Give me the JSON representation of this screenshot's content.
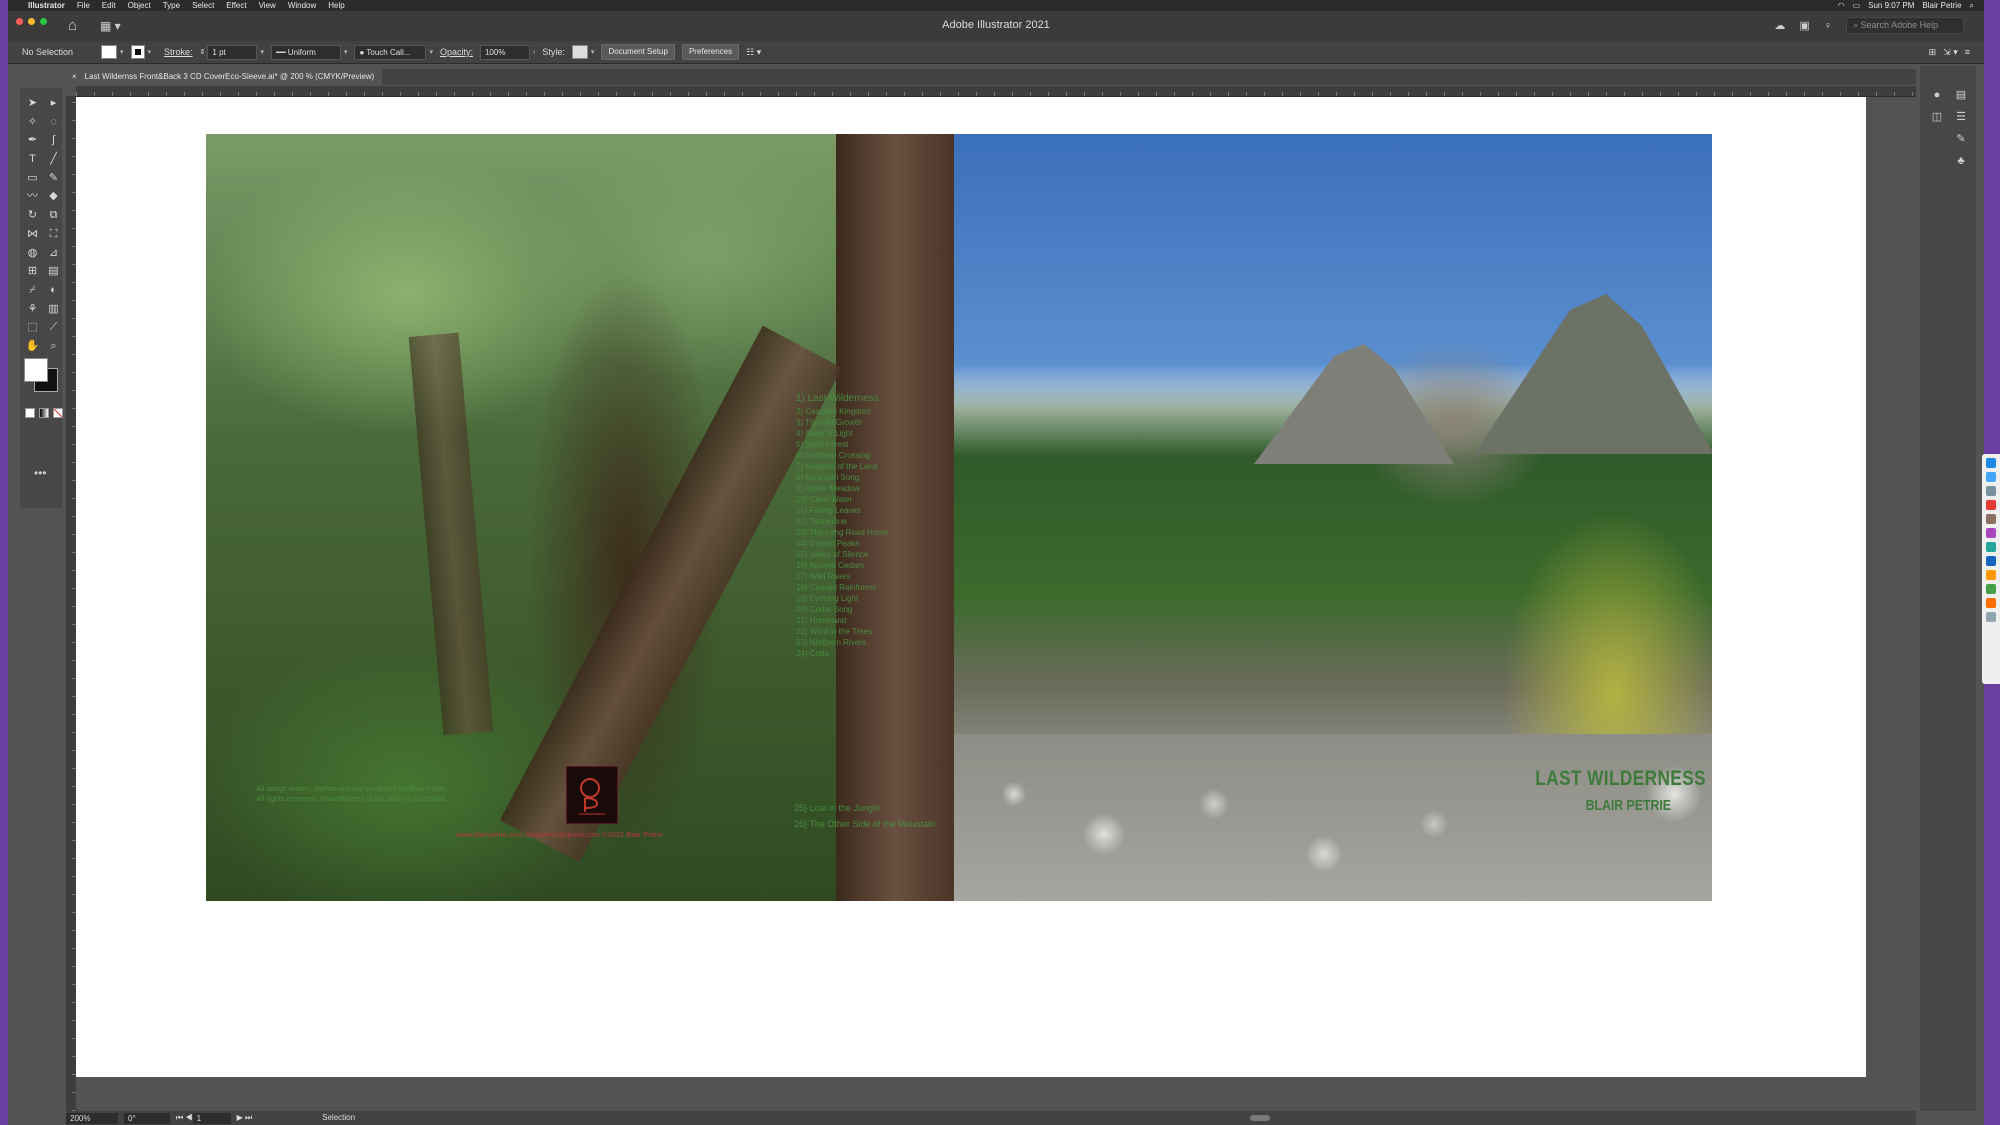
{
  "menubar": {
    "apple": "",
    "items": [
      "Illustrator",
      "File",
      "Edit",
      "Object",
      "Type",
      "Select",
      "Effect",
      "View",
      "Window",
      "Help"
    ],
    "clock": "Sun 9:07 PM",
    "user": "Blair Petrie"
  },
  "titlebar": {
    "app_title": "Adobe Illustrator 2021",
    "search_placeholder": "Search Adobe Help"
  },
  "controlbar": {
    "selection": "No Selection",
    "stroke_label": "Stroke:",
    "stroke_weight": "1 pt",
    "stroke_profile": "Uniform",
    "brush": "Touch Call...",
    "opacity_label": "Opacity:",
    "opacity_value": "100%",
    "style_label": "Style:",
    "document_setup": "Document Setup",
    "preferences": "Preferences"
  },
  "document": {
    "tab_title": "Last Wildernss Front&Back 3 CD CoverEco-Sleeve.ai* @ 200 % (CMYK/Preview)",
    "close": "×"
  },
  "cover": {
    "title": "LAST WILDERNESS",
    "author": "BLAIR PETRIE",
    "tracklist_heading": "1) Last Wilderness",
    "tracks": [
      "2) Cascade Kingdom",
      "3) The Old Growth",
      "4) River of Light",
      "5) Spirit Forest",
      "6) Northern Crossing",
      "7) Keepers of the Land",
      "8) Mountain Song",
      "9) Alpine Meadow",
      "10) Clear Water",
      "11) Falling Leaves",
      "12) Timberline",
      "13) The Long Road Home",
      "14) Distant Peaks",
      "15) Valley of Silence",
      "16) Ancient Cedars",
      "17) Wild Rivers",
      "18) Coastal Rainforest",
      "19) Evening Light",
      "20) Cedar Song",
      "21) Homeland",
      "22) Wind in the Trees",
      "23) Northern Rivers",
      "24) Coda"
    ],
    "bottom_tracks": [
      "25) Lost in the Jungle",
      "26) The Other Side of the Mountain"
    ],
    "credits": [
      "All songs written, performed and produced by Blair Petrie",
      "All rights reserved. Unauthorized duplication is prohibited."
    ],
    "red_line": "www.blairpetrie.com    blairpetrie@gmail.com    ©2021    Blair Petrie"
  },
  "statusbar": {
    "zoom": "200%",
    "rotation": "0°",
    "artboard": "1",
    "tool": "Selection"
  },
  "colors": {
    "cover_text_green": "#3e7a3a",
    "red_text": "#b33a3a",
    "ui_dark": "#535353"
  }
}
